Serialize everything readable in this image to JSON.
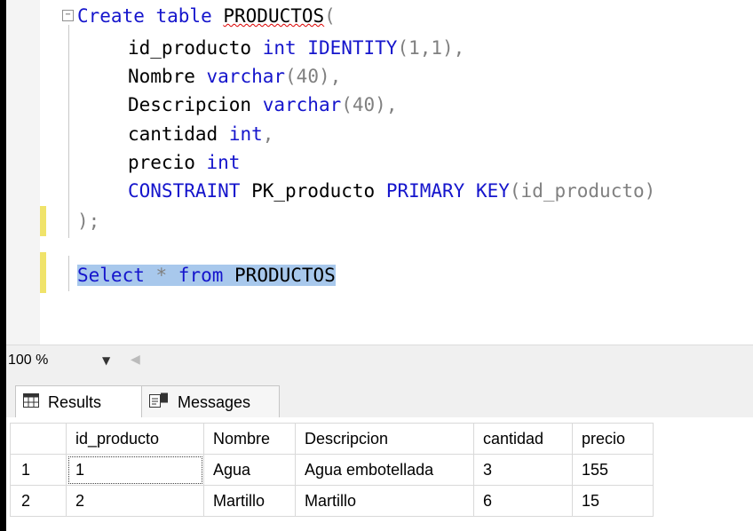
{
  "editor": {
    "lines": [
      {
        "kw1": "Create table",
        "name": "PRODUCTOS",
        "punct": "("
      },
      {
        "col": "id_producto",
        "type": "int IDENTITY",
        "args": "(1,1),"
      },
      {
        "col": "Nombre",
        "type": "varchar",
        "args": "(40),"
      },
      {
        "col": "Descripcion",
        "type": "varchar",
        "args": "(40),"
      },
      {
        "col": "cantidad",
        "type": "int",
        "args": ","
      },
      {
        "col": "precio",
        "type": "int",
        "args": ""
      },
      {
        "kw1": "CONSTRAINT",
        "name": "PK_producto",
        "kw2": "PRIMARY KEY",
        "args": "(id_producto)"
      },
      {
        "text": ");"
      },
      {
        "kw1": "Select",
        "star": " * ",
        "kw2": "from",
        "name": "PRODUCTOS"
      }
    ],
    "accent_color": "#1515cc",
    "selection_color": "#a8c8ec"
  },
  "toolbar": {
    "zoom_value": "100 %",
    "dropdown_icon": "chevron-down-icon"
  },
  "tabs": [
    {
      "label": "Results",
      "icon": "grid-icon"
    },
    {
      "label": "Messages",
      "icon": "messages-icon"
    }
  ],
  "results": {
    "columns": [
      "id_producto",
      "Nombre",
      "Descripcion",
      "cantidad",
      "precio"
    ],
    "rows": [
      {
        "num": "1",
        "cells": [
          "1",
          "Agua",
          "Agua embotellada",
          "3",
          "155"
        ]
      },
      {
        "num": "2",
        "cells": [
          "2",
          "Martillo",
          "Martillo",
          "6",
          "15"
        ]
      }
    ]
  }
}
